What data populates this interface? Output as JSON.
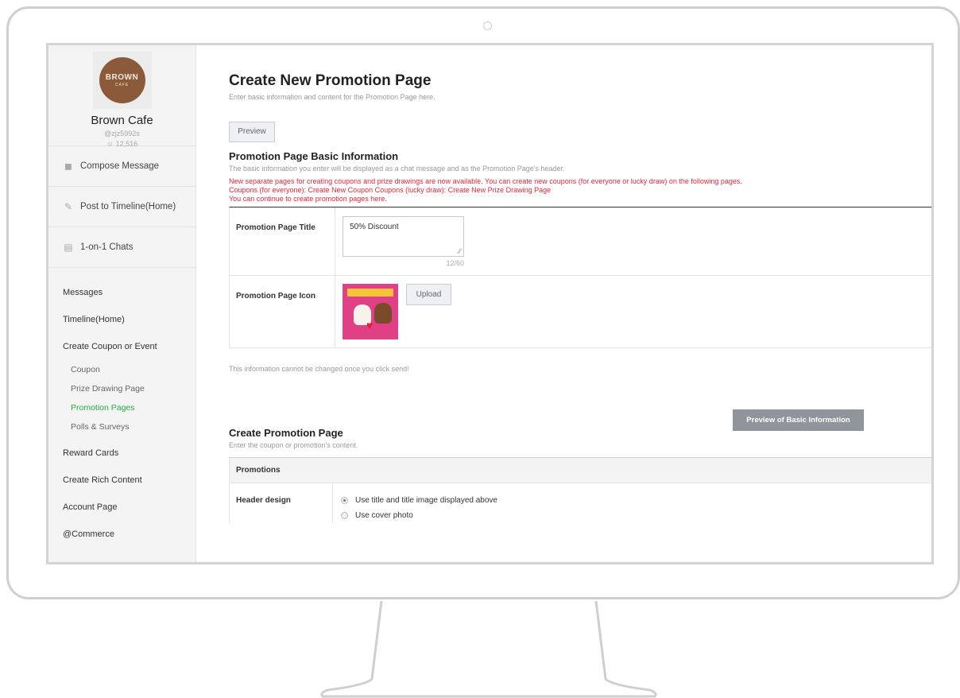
{
  "profile": {
    "logo_line1": "BROWN",
    "logo_line2": "CAFE",
    "name": "Brown Cafe",
    "handle": "@zjz5992s",
    "followers": "12,516"
  },
  "sidebar": {
    "actions": [
      {
        "label": "Compose Message",
        "icon": "speaker-icon"
      },
      {
        "label": "Post to Timeline(Home)",
        "icon": "edit-icon"
      },
      {
        "label": "1-on-1 Chats",
        "icon": "chat-icon"
      }
    ],
    "nav": {
      "messages": "Messages",
      "timeline": "Timeline(Home)",
      "coupon_event": "Create Coupon or Event",
      "coupon": "Coupon",
      "prize_drawing": "Prize Drawing Page",
      "promotion_pages": "Promotion Pages",
      "polls": "Polls & Surveys",
      "reward_cards": "Reward Cards",
      "rich_content": "Create Rich Content",
      "account_page": "Account Page",
      "commerce": "@Commerce"
    }
  },
  "main": {
    "title": "Create New Promotion Page",
    "description": "Enter basic information and content for the Promotion Page here.",
    "preview_label": "Preview",
    "basic": {
      "title": "Promotion Page Basic Information",
      "description": "The basic information you enter will be displayed as a chat message and as the Promotion Page's header.",
      "notice_line1": "New separate pages for creating coupons and prize drawings are now available. You can create new coupons (for everyone or lucky draw) on the following pages.",
      "notice_line2": "Coupons (for everyone): Create New Coupon Coupons (lucky draw): Create New Prize Drawing Page",
      "notice_line3": "You can continue to create promotion pages here.",
      "title_label": "Promotion Page Title",
      "title_value": "50% Discount",
      "char_count": "12/60",
      "icon_label": "Promotion Page Icon",
      "upload_label": "Upload",
      "info_note": "This information cannot be changed once you click send!",
      "preview_basic_label": "Preview of Basic Information"
    },
    "create": {
      "title": "Create Promotion Page",
      "description": "Enter the coupon or promotion's content.",
      "table_head": "Promotions",
      "header_design_label": "Header design",
      "option1": "Use title and title image displayed above",
      "option2": "Use cover photo"
    }
  },
  "colors": {
    "accent_green": "#2aa842",
    "notice_red": "#d62a3a",
    "brand_brown": "#8a5a3a"
  }
}
